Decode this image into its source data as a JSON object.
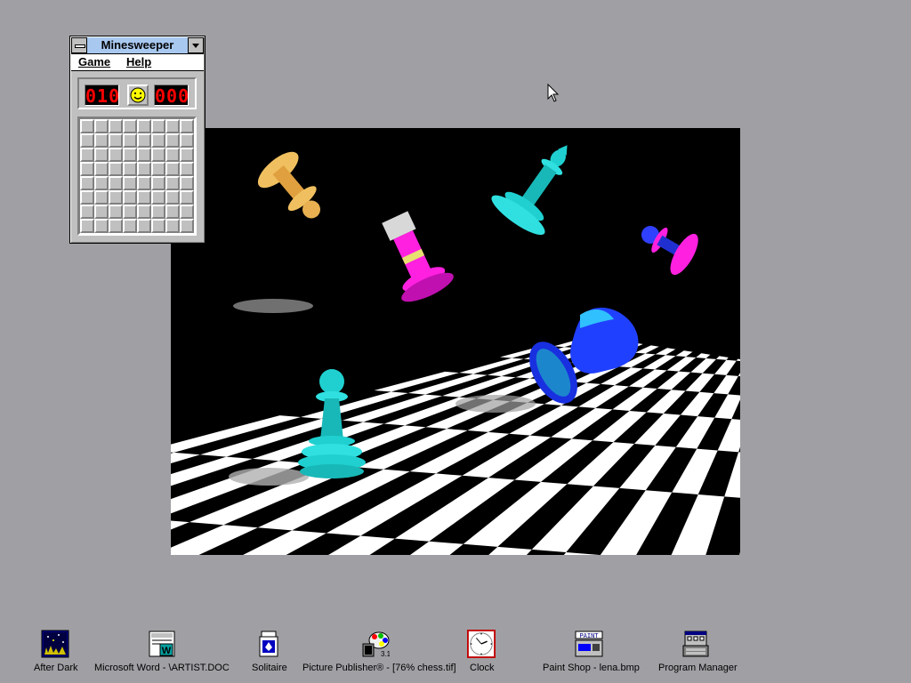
{
  "desktop": {
    "background": "#a0a0a4"
  },
  "minesweeper": {
    "title": "Minesweeper",
    "menu": [
      "Game",
      "Help"
    ],
    "mines_counter": "010",
    "timer": "000",
    "face_icon": "smiley-face-icon",
    "grid": {
      "rows": 8,
      "cols": 8
    }
  },
  "picture": {
    "subject": "chess pieces over checkerboard",
    "pieces": [
      {
        "name": "pawn",
        "color": "#f0c060"
      },
      {
        "name": "king",
        "color": "#20d0d0"
      },
      {
        "name": "rook",
        "color": "#ff20e0"
      },
      {
        "name": "pawn",
        "color": "#ff20e0"
      },
      {
        "name": "knight",
        "color": "#2040ff"
      },
      {
        "name": "pawn",
        "color": "#20d0d0"
      }
    ]
  },
  "icons": [
    {
      "label": "After Dark",
      "icon": "after-dark-icon"
    },
    {
      "label": "Microsoft Word - \\ARTIST.DOC",
      "icon": "word-icon"
    },
    {
      "label": "Solitaire",
      "icon": "solitaire-icon"
    },
    {
      "label": "Picture Publisher® - [76% chess.tif]",
      "icon": "picture-publisher-icon"
    },
    {
      "label": "Clock",
      "icon": "clock-icon"
    },
    {
      "label": "Paint Shop - lena.bmp",
      "icon": "paint-shop-icon"
    },
    {
      "label": "Program Manager",
      "icon": "program-manager-icon"
    }
  ]
}
